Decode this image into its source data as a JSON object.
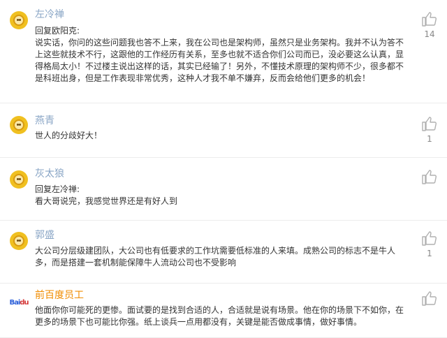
{
  "comments": [
    {
      "username": "左冷禅",
      "reply_line": "回复欧阳克:",
      "text": "说实话，你问的这些问题我也答不上来，我在公司也是架构师，虽然只是业务架构。我并不认为答不上这些就技术不行，这跟他的工作经历有关系，至多也就不适合你们公司而已，没必要这么认真，显得格局太小！不过楼主说出这样的话，其实已经输了！另外，不懂技术原理的架构师不少，很多都不是科班出身，但是工作表现非常优秀，这种人才我不单不嫌弃，反而会给他们更多的机会！",
      "likes": "14"
    },
    {
      "username": "燕青",
      "text": "世人的分歧好大！",
      "likes": "1"
    },
    {
      "username": "灰太狼",
      "reply_line": "回复左冷禅:",
      "text": "看大哥说完，我感觉世界还是有好人到",
      "likes": ""
    },
    {
      "username": "郭盛",
      "text": "大公司分层级建团队，大公司也有低要求的工作坑需要低标准的人来填。成熟公司的标志不是牛人多，而是搭建一套机制能保障牛人流动公司也不受影响",
      "likes": "1"
    },
    {
      "username": "前百度员工",
      "username_color": "#f08c00",
      "avatar_logo": "Bai du",
      "text": "他面你你可能死的更惨。面试要的是找到合适的人，合适就是说有场景。他在你的场景下不如你，在更多的场景下也可能比你强。纸上谈兵一点用都没有，关键是能否做成事情，做好事情。",
      "likes": ""
    }
  ]
}
